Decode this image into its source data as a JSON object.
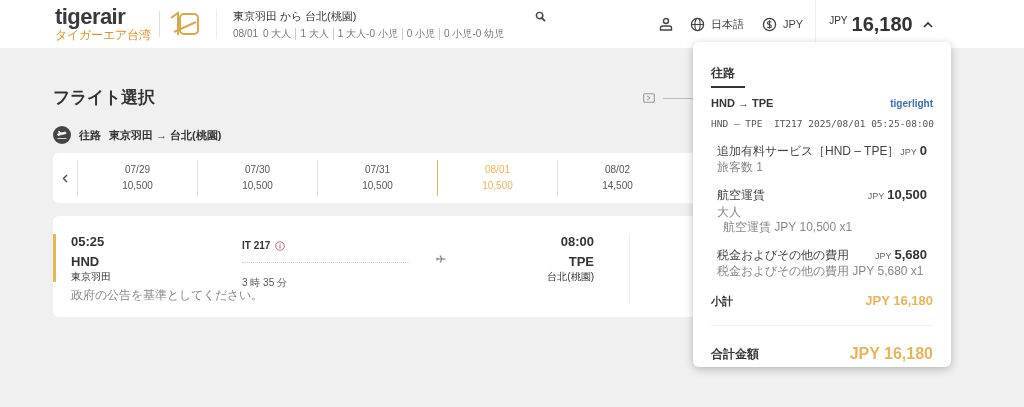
{
  "header": {
    "logo": "tigerair",
    "logo_sub": "タイガーエア台湾",
    "route": "東京羽田 から 台北(桃園)",
    "date": "08/01",
    "passengers": [
      "0 大人",
      "1 大人",
      "1 大人-0 小児",
      "0 小児",
      "0 小児-0 幼児"
    ],
    "language": "日本語",
    "currency": "JPY",
    "total_currency": "JPY",
    "total": "16,180",
    "expanded": true
  },
  "page_title": "フライト選択",
  "leg": {
    "label": "往路",
    "route": "東京羽田 → 台北(桃園)"
  },
  "dates": [
    {
      "date": "07/29",
      "price": "10,500",
      "selected": false
    },
    {
      "date": "07/30",
      "price": "10,500",
      "selected": false
    },
    {
      "date": "07/31",
      "price": "10,500",
      "selected": false
    },
    {
      "date": "08/01",
      "price": "10,500",
      "selected": true
    },
    {
      "date": "08/02",
      "price": "14,500",
      "selected": false
    }
  ],
  "flight": {
    "depart_time": "05:25",
    "depart_code": "HND",
    "depart_city": "東京羽田",
    "number": "IT 217",
    "duration": "3 時 35 分",
    "arrive_time": "08:00",
    "arrive_code": "TPE",
    "arrive_city": "台北(桃園)",
    "note": "政府の公告を基準としてください。"
  },
  "summary": {
    "heading": "往路",
    "route": "HND → TPE",
    "fare": "tigerlight",
    "detail": "HND – TPE  IT217 2025/08/01 05:25-08:00",
    "items": [
      {
        "label": "追加有料サービス［HND – TPE］",
        "currency": "JPY",
        "amount": "0",
        "notes": [
          "旅客数 1"
        ]
      },
      {
        "label": "航空運賃",
        "currency": "JPY",
        "amount": "10,500",
        "notes": [
          "大人",
          "航空運賃 JPY 10,500 x1"
        ]
      },
      {
        "label": "税金およびその他の費用",
        "currency": "JPY",
        "amount": "5,680",
        "notes": [
          "税金およびその他の費用 JPY 5,680 x1"
        ]
      }
    ],
    "subtotal_label": "小計",
    "subtotal": "JPY 16,180",
    "total_label": "合計金額",
    "total": "JPY 16,180"
  }
}
